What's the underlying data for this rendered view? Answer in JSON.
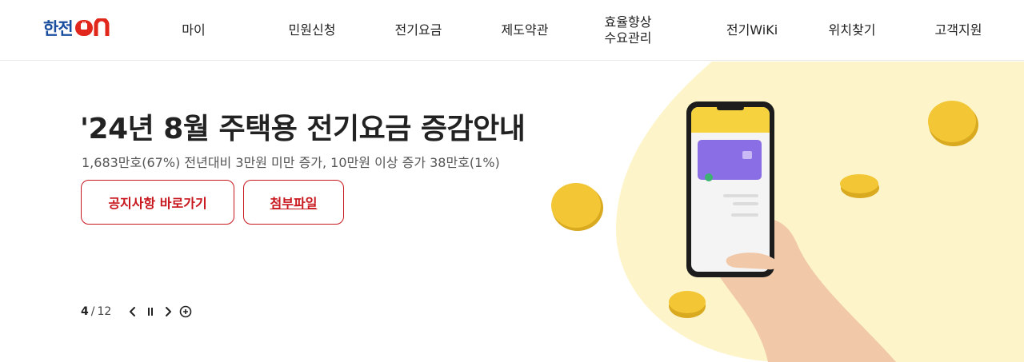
{
  "header": {
    "logo_text": "한전",
    "logo_on": "ON",
    "nav": [
      {
        "label": "마이",
        "key": "my"
      },
      {
        "label": "민원신청",
        "key": "civil"
      },
      {
        "label": "전기요금",
        "key": "bill"
      },
      {
        "label": "제도약관",
        "key": "terms"
      },
      {
        "label": "효율향상\n수요관리",
        "key": "efficiency"
      },
      {
        "label": "전기WiKi",
        "key": "wiki"
      },
      {
        "label": "위치찾기",
        "key": "location"
      },
      {
        "label": "고객지원",
        "key": "support"
      }
    ]
  },
  "hero": {
    "title": "'24년 8월 주택용 전기요금 증감안내",
    "subtitle": "1,683만호(67%) 전년대비 3만원 미만 증가, 10만원 이상 증가 38만호(1%)",
    "buttons": {
      "notice": "공지사항 바로가기",
      "attachment": "첨부파일"
    },
    "pager": {
      "current": "4",
      "separator": "/",
      "total": "12"
    }
  },
  "colors": {
    "brand_blue": "#1a4fa0",
    "brand_red": "#c8161d",
    "accent_yellow": "#fdf3c4",
    "coin": "#f2c634"
  },
  "icons": {
    "prev": "chevron-left-icon",
    "pause": "pause-icon",
    "next": "chevron-right-icon",
    "add": "plus-circle-icon"
  }
}
